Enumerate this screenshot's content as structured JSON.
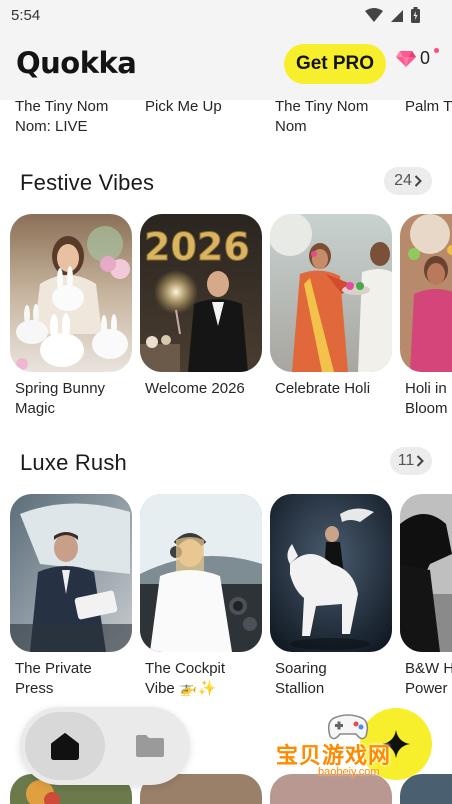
{
  "status": {
    "time": "5:54"
  },
  "header": {
    "app_name": "Quokka",
    "get_pro": "Get PRO",
    "gem_count": "0",
    "brand_yellow": "#f7ee2c",
    "gem_color": "#ff4b8b"
  },
  "previous_row": {
    "labels": [
      "The Tiny Nom\nNom: LIVE",
      "Pick Me Up",
      "The Tiny Nom\nNom",
      "Palm T"
    ]
  },
  "sections": [
    {
      "title": "Festive Vibes",
      "count": "24",
      "cards": [
        {
          "label": "Spring Bunny\nMagic"
        },
        {
          "label": "Welcome 2026"
        },
        {
          "label": "Celebrate Holi"
        },
        {
          "label": "Holi in\nBloom"
        }
      ]
    },
    {
      "title": "Luxe Rush",
      "count": "11",
      "cards": [
        {
          "label": "The Private\nPress"
        },
        {
          "label": "The Cockpit\nVibe 🚁✨"
        },
        {
          "label": "Soaring\nStallion"
        },
        {
          "label": "B&W H\nPower"
        }
      ]
    }
  ],
  "nav": {
    "items": [
      "home-icon",
      "folder-icon"
    ]
  },
  "fab": {
    "icon": "sparkle-icon"
  },
  "watermark": {
    "text": "宝贝游戏网",
    "url": "baobeiy.com"
  }
}
